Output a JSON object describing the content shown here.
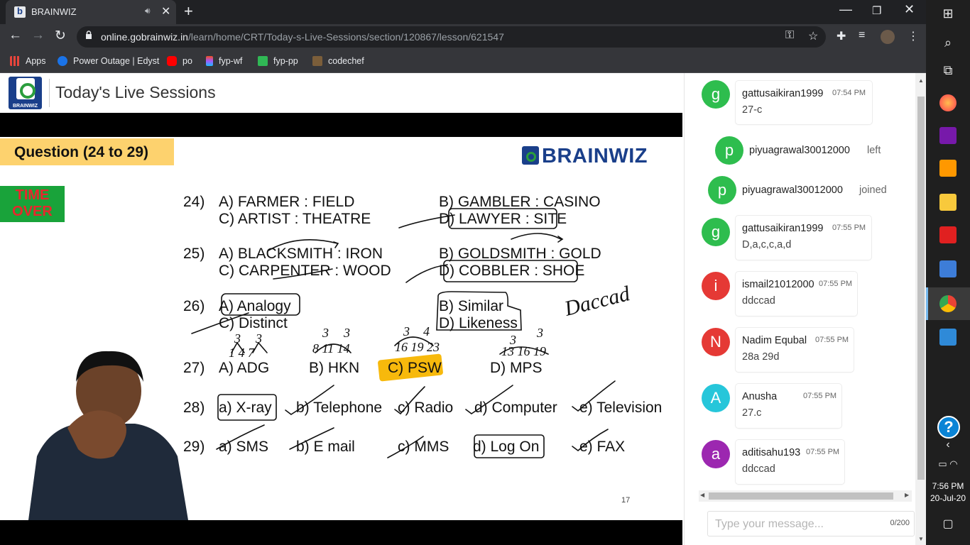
{
  "browser": {
    "tab_title": "BRAINWIZ",
    "url_host": "online.gobrainwiz.in",
    "url_path": "/learn/home/CRT/Today-s-Live-Sessions/section/120867/lesson/621547",
    "bookmarks": [
      {
        "label": "Apps",
        "color": "#e8453c"
      },
      {
        "label": "Power Outage | Edyst",
        "color": "#1a73e8"
      },
      {
        "label": "po",
        "color": "#ff0000"
      },
      {
        "label": "fyp-wf",
        "color": "#f24e1e"
      },
      {
        "label": "fyp-pp",
        "color": "#30b855"
      },
      {
        "label": "codechef",
        "color": "#7b5e3a"
      }
    ]
  },
  "header": {
    "title": "Today's Live Sessions",
    "logo_text": "BRAINWIZ"
  },
  "slide": {
    "banner": "Question (24 to 29)",
    "time_over_1": "TIME",
    "time_over_2": "OVER",
    "brand": "BRAINWIZ",
    "page_number": "17",
    "questions": {
      "q24": {
        "num": "24)",
        "a": "A) FARMER : FIELD",
        "b": "B) GAMBLER : CASINO",
        "c": "C) ARTIST : THEATRE",
        "d": "D) LAWYER : SITE"
      },
      "q25": {
        "num": "25)",
        "a": "A) BLACKSMITH : IRON",
        "b": "B) GOLDSMITH : GOLD",
        "c": "C) CARPENTER : WOOD",
        "d": "D) COBBLER : SHOE"
      },
      "q26": {
        "num": "26)",
        "a": "A) Analogy",
        "b": "B) Similar",
        "c": "C) Distinct",
        "d": "D) Likeness"
      },
      "q27": {
        "num": "27)",
        "a": "A) ADG",
        "b": "B) HKN",
        "c": "C) PSW",
        "d": "D) MPS"
      },
      "q28": {
        "num": "28)",
        "a": "a) X-ray",
        "b": "b) Telephone",
        "c": "c) Radio",
        "d": "d) Computer",
        "e": "e) Television"
      },
      "q29": {
        "num": "29)",
        "a": "a) SMS",
        "b": "b) E mail",
        "c": "c) MMS",
        "d": "d) Log On",
        "e": "e) FAX"
      }
    },
    "handwriting": {
      "answer": "Daccad",
      "n1": "3",
      "n2": "3",
      "n3": "3",
      "n4": "3",
      "n5": "3",
      "n6": "4",
      "n7": "3",
      "n8": "3",
      "seq_a": "1 4 7",
      "seq_b": "8 11 14",
      "seq_c": "16 19 23",
      "seq_d": "13 16 19"
    }
  },
  "chat": {
    "messages": [
      {
        "initial": "g",
        "color": "#2ebd4e",
        "user": "gattusaikiran1999",
        "time": "07:54 PM",
        "text": "27-c"
      },
      {
        "initial": "p",
        "color": "#2ebd4e",
        "user": "piyuagrawal30012000",
        "status": "left"
      },
      {
        "initial": "p",
        "color": "#2ebd4e",
        "user": "piyuagrawal30012000",
        "status": "joined"
      },
      {
        "initial": "g",
        "color": "#2ebd4e",
        "user": "gattusaikiran1999",
        "time": "07:55 PM",
        "text": "D,a,c,c,a,d"
      },
      {
        "initial": "i",
        "color": "#e53935",
        "user": "ismail21012000",
        "time": "07:55 PM",
        "text": "ddccad"
      },
      {
        "initial": "N",
        "color": "#e53935",
        "user": "Nadim Equbal",
        "time": "07:55 PM",
        "text": "28a 29d"
      },
      {
        "initial": "A",
        "color": "#26c6da",
        "user": "Anusha",
        "time": "07:55 PM",
        "text": "27.c"
      },
      {
        "initial": "a",
        "color": "#9c27b0",
        "user": "aditisahu193",
        "time": "07:55 PM",
        "text": "ddccad"
      }
    ],
    "input_placeholder": "Type your message...",
    "char_count": "0/200"
  },
  "taskbar": {
    "time": "7:56 PM",
    "date": "20-Jul-20",
    "help": "?"
  }
}
